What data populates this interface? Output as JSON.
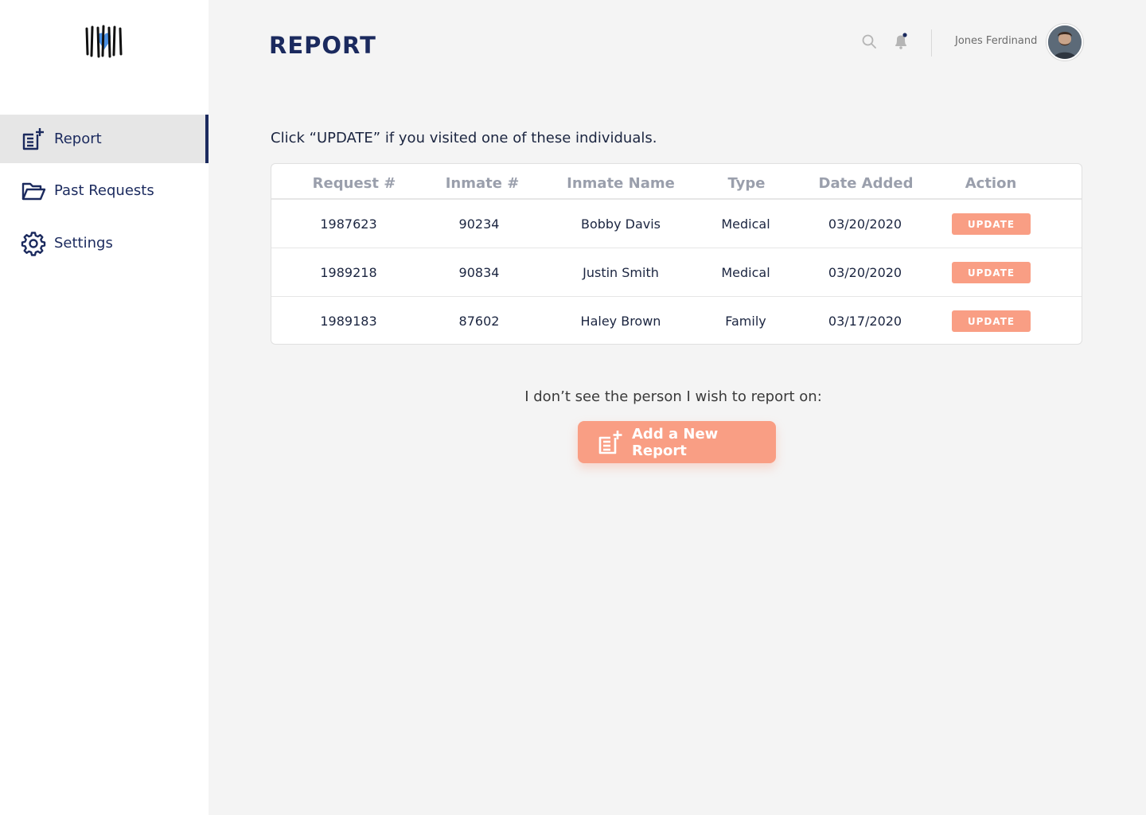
{
  "sidebar": {
    "items": [
      {
        "label": "Report",
        "icon": "report-add-icon",
        "active": true
      },
      {
        "label": "Past Requests",
        "icon": "folder-open-icon",
        "active": false
      },
      {
        "label": "Settings",
        "icon": "gear-icon",
        "active": false
      }
    ]
  },
  "header": {
    "title": "REPORT",
    "user_name": "Jones Ferdinand"
  },
  "main": {
    "instruction": "Click “UPDATE” if you visited one of these individuals.",
    "table": {
      "columns": [
        "Request #",
        "Inmate #",
        "Inmate Name",
        "Type",
        "Date Added",
        "Action"
      ],
      "rows": [
        {
          "request": "1987623",
          "inmate": "90234",
          "name": "Bobby Davis",
          "type": "Medical",
          "date": "03/20/2020",
          "action": "UPDATE"
        },
        {
          "request": "1989218",
          "inmate": "90834",
          "name": "Justin Smith",
          "type": "Medical",
          "date": "03/20/2020",
          "action": "UPDATE"
        },
        {
          "request": "1989183",
          "inmate": "87602",
          "name": "Haley Brown",
          "type": "Family",
          "date": "03/17/2020",
          "action": "UPDATE"
        }
      ]
    },
    "no_person_text": "I don’t see the person I wish to report on:",
    "add_button_label": "Add a New Report"
  },
  "colors": {
    "accent": "#f99e84",
    "navy": "#1b2a5e",
    "logo_heart": "#4a90e2"
  }
}
